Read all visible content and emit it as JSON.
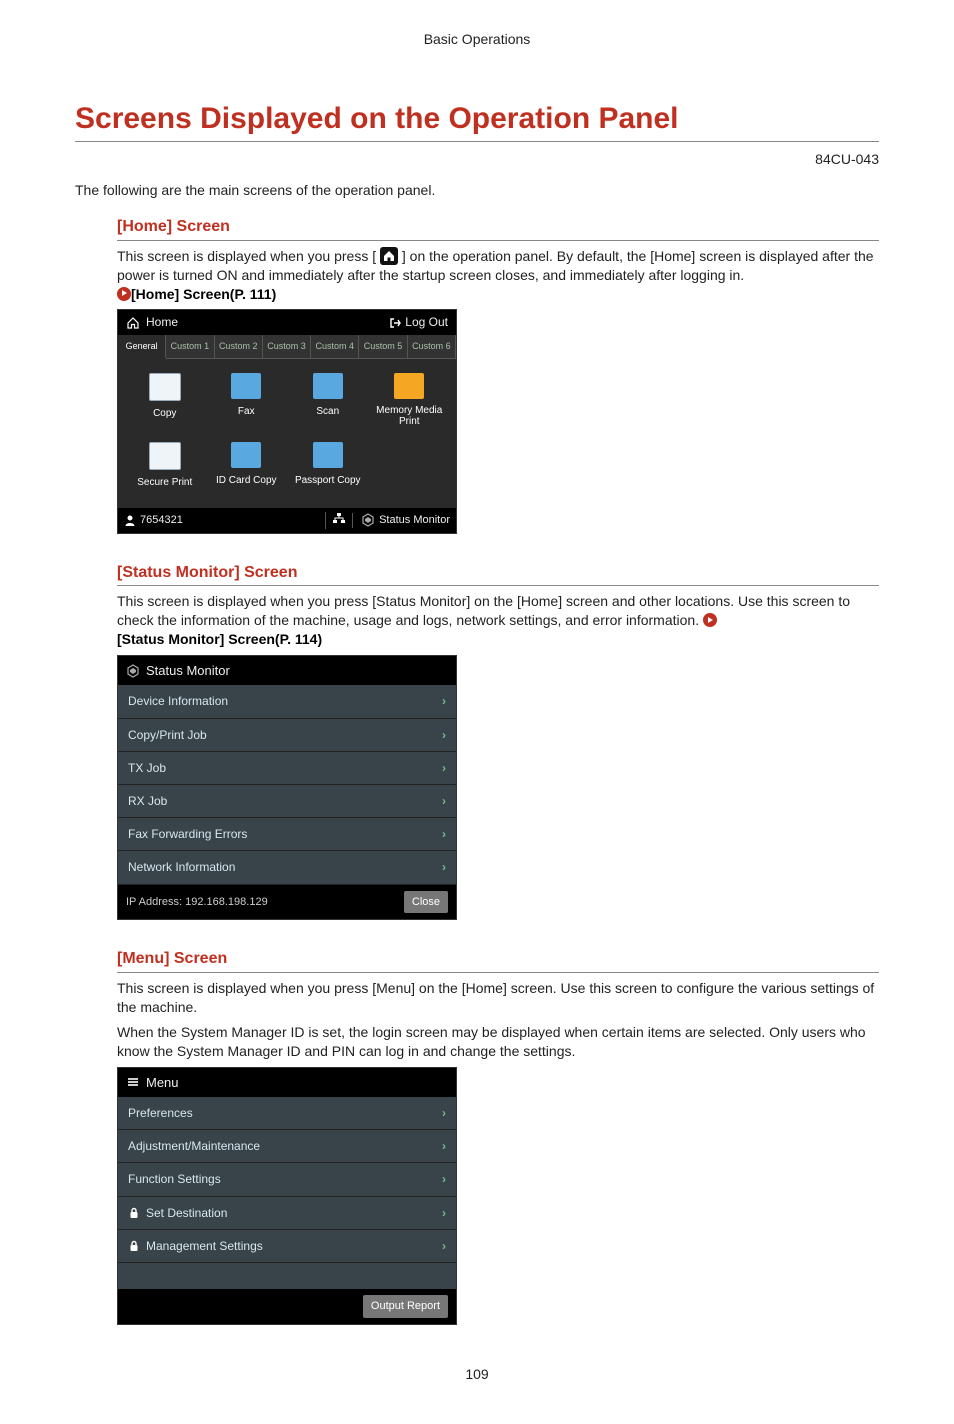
{
  "breadcrumb": "Basic Operations",
  "page_title": "Screens Displayed on the Operation Panel",
  "doc_code": "84CU-043",
  "intro": "The following are the main screens of the operation panel.",
  "page_number": "109",
  "sections": {
    "home": {
      "heading": "[Home] Screen",
      "desc_part1": "This screen is displayed when you press [",
      "desc_part2": "] on the operation panel. By default, the [Home] screen is displayed after the power is turned ON and immediately after the startup screen closes, and immediately after logging in.",
      "ref": "[Home] Screen(P. 111)"
    },
    "status": {
      "heading": "[Status Monitor] Screen",
      "desc": "This screen is displayed when you press [Status Monitor] on the [Home] screen and other locations. Use this screen to check the information of the machine, usage and logs, network settings, and error information.",
      "ref": "[Status Monitor] Screen(P. 114)"
    },
    "menu": {
      "heading": "[Menu] Screen",
      "desc1": "This screen is displayed when you press [Menu] on the [Home] screen. Use this screen to configure the various settings of the machine.",
      "desc2": "When the System Manager ID is set, the login screen may be displayed when certain items are selected. Only users who know the System Manager ID and PIN can log in and change the settings."
    }
  },
  "home_shot": {
    "title": "Home",
    "logout": "Log Out",
    "tabs": [
      "General",
      "Custom 1",
      "Custom 2",
      "Custom 3",
      "Custom 4",
      "Custom 5",
      "Custom 6"
    ],
    "icons": {
      "copy": "Copy",
      "fax": "Fax",
      "scan": "Scan",
      "memory": "Memory Media Print",
      "secure": "Secure Print",
      "idcard": "ID Card Copy",
      "passport": "Passport Copy"
    },
    "user_id": "7654321",
    "status_monitor": "Status Monitor"
  },
  "status_shot": {
    "title": "Status Monitor",
    "items": [
      "Device Information",
      "Copy/Print Job",
      "TX Job",
      "RX Job",
      "Fax Forwarding Errors",
      "Network Information"
    ],
    "ip_label": "IP Address: 192.168.198.129",
    "close": "Close"
  },
  "menu_shot": {
    "title": "Menu",
    "items": {
      "pref": "Preferences",
      "adj": "Adjustment/Maintenance",
      "func": "Function Settings",
      "setdest": "Set Destination",
      "mgmt": "Management Settings"
    },
    "output": "Output Report"
  }
}
